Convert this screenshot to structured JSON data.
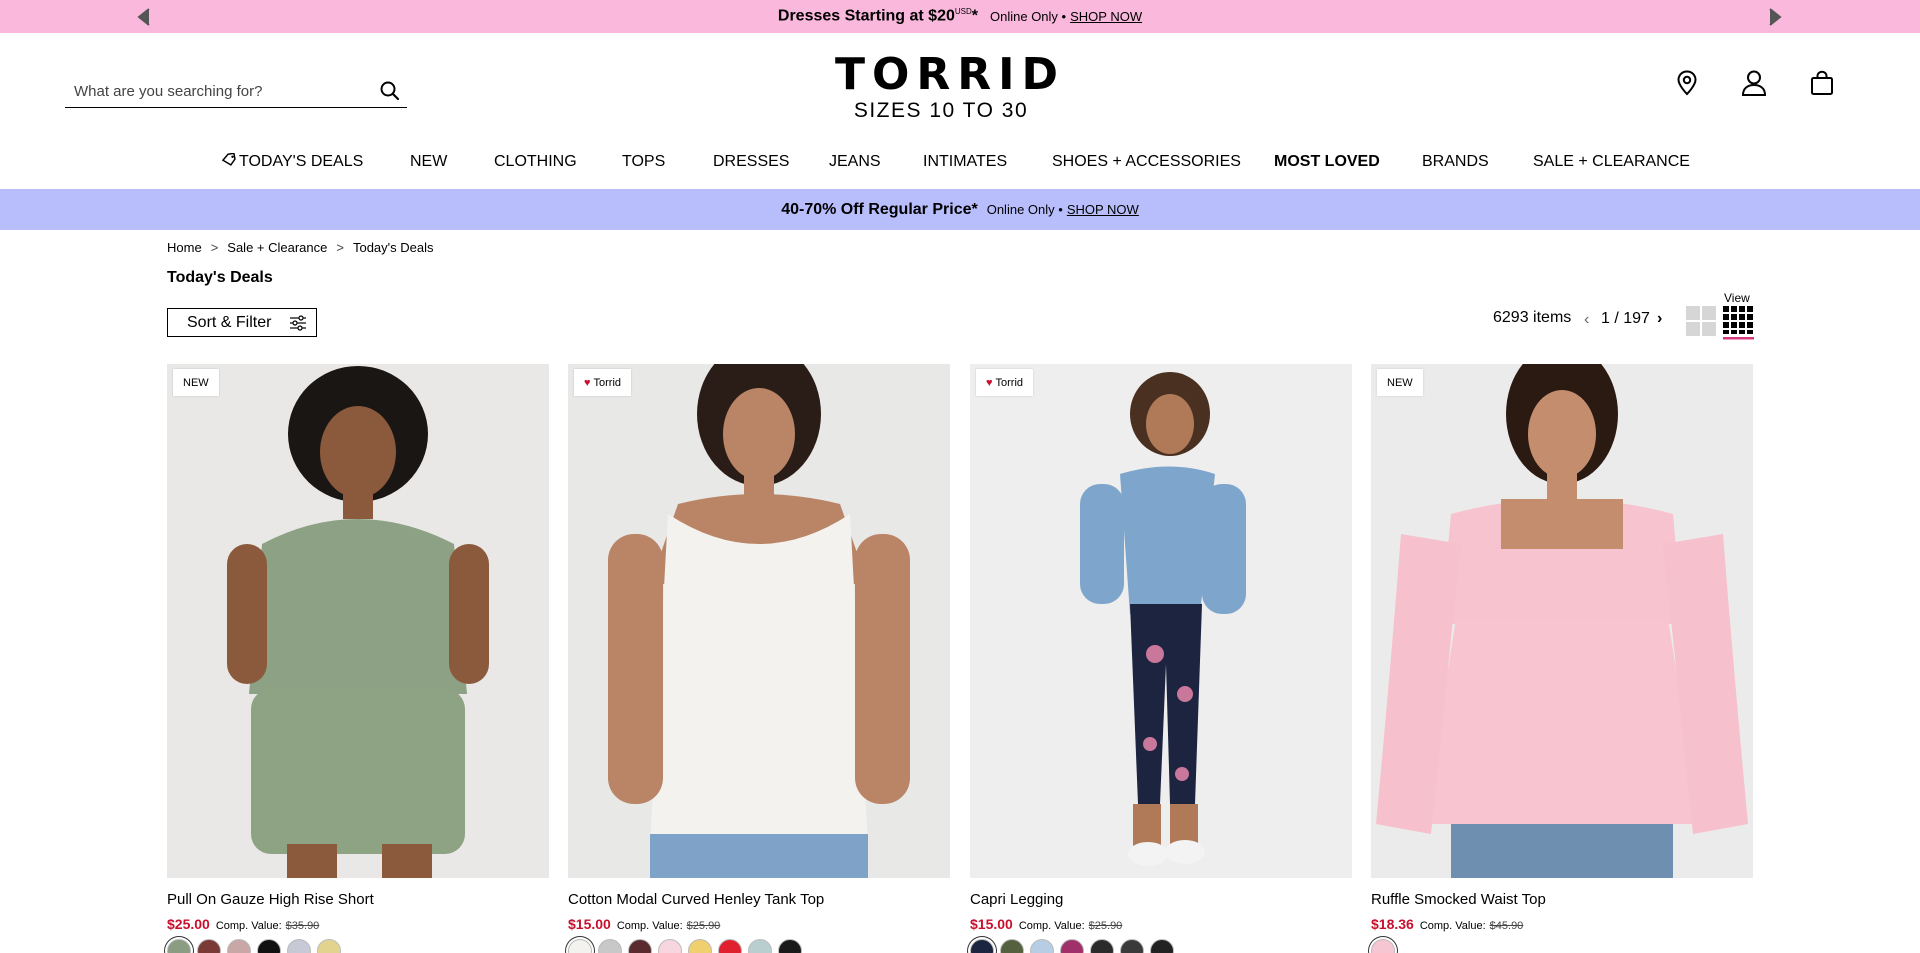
{
  "promo_top": {
    "headline": "Dresses Starting at $20",
    "headline_sup": "USD",
    "headline_suffix": "*",
    "sub": "Online Only •",
    "cta": "SHOP NOW",
    "bg": "#f9b8dc"
  },
  "header": {
    "search": {
      "placeholder": "What are you searching for?",
      "value": ""
    },
    "logo": {
      "brand": "TORRID",
      "tagline": "SIZES 10 TO 30"
    },
    "icons": [
      "location-pin-icon",
      "account-icon",
      "shopping-bag-icon"
    ]
  },
  "nav": {
    "items": [
      {
        "label": "TODAY'S DEALS",
        "icon": "tag-icon"
      },
      {
        "label": "NEW"
      },
      {
        "label": "CLOTHING"
      },
      {
        "label": "TOPS"
      },
      {
        "label": "DRESSES"
      },
      {
        "label": "JEANS"
      },
      {
        "label": "INTIMATES"
      },
      {
        "label": "SHOES + ACCESSORIES"
      },
      {
        "label": "MOST LOVED",
        "bold": true
      },
      {
        "label": "BRANDS"
      },
      {
        "label": "SALE + CLEARANCE"
      }
    ]
  },
  "promo_mid": {
    "headline": "40-70% Off Regular Price*",
    "sub": "Online Only •",
    "cta": "SHOP NOW",
    "bg": "#b8bdfc"
  },
  "breadcrumb": {
    "items": [
      "Home",
      "Sale + Clearance",
      "Today's Deals"
    ],
    "separator": ">"
  },
  "page_title": "Today's Deals",
  "toolbar": {
    "sort_filter_label": "Sort & Filter",
    "items_count": "6293 items",
    "page_prev": "‹",
    "page_indicator": "1 / 197",
    "page_next": "›",
    "view_label": "View"
  },
  "products": [
    {
      "badge": "NEW",
      "badge_heart": false,
      "name": "Pull On Gauze High Rise Short",
      "price": "$25.00",
      "comp_label": "Comp. Value:",
      "comp_value": "$35.90",
      "swatches": [
        "#8a9c82",
        "#7a3a35",
        "#c9a7a7",
        "#111111",
        "#c7c9d6",
        "#e2d38f"
      ]
    },
    {
      "badge": "Torrid",
      "badge_heart": true,
      "name": "Cotton Modal Curved Henley Tank Top",
      "price": "$15.00",
      "comp_label": "Comp. Value:",
      "comp_value": "$25.90",
      "swatches": [
        "#f4f2ee",
        "#c8c8c8",
        "#5a2b2e",
        "#f7d6df",
        "#f0cf6e",
        "#e0202e",
        "#b9cfcf",
        "#1a1a1a"
      ]
    },
    {
      "badge": "Torrid",
      "badge_heart": true,
      "name": "Capri Legging",
      "price": "$15.00",
      "comp_label": "Comp. Value:",
      "comp_value": "$25.90",
      "swatches": [
        "#1c2540",
        "#55603e",
        "#b7cde3",
        "#a0306a",
        "#2b2b2b",
        "#3a3a3a",
        "#222222"
      ]
    },
    {
      "badge": "NEW",
      "badge_heart": false,
      "name": "Ruffle Smocked Waist Top",
      "price": "$18.36",
      "comp_label": "Comp. Value:",
      "comp_value": "$45.90",
      "swatches": [
        "#f6c6d3"
      ]
    }
  ],
  "colors": {
    "price_red": "#c8102e",
    "view_active_underline": "#d6387c"
  }
}
